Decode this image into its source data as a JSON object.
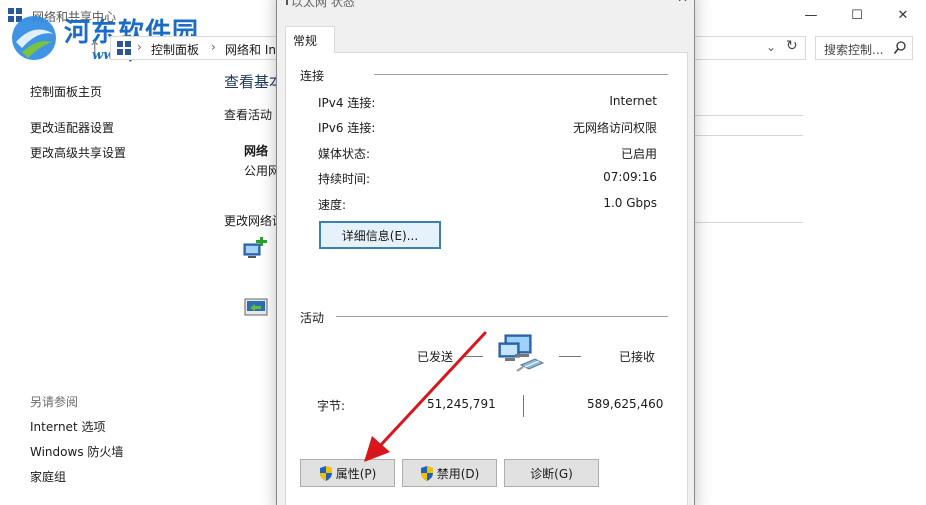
{
  "background_window": {
    "title": "网络和共享中心",
    "controls": {
      "minimize": "—",
      "maximize": "☐",
      "close": "✕"
    },
    "address_bar": {
      "crumbs": [
        "控制面板",
        "网络和 In"
      ],
      "search_placeholder": "搜索控制..."
    },
    "left_nav": {
      "home": "控制面板主页",
      "links": [
        "更改适配器设置",
        "更改高级共享设置"
      ],
      "see_also_title": "另请参阅",
      "see_also": [
        "Internet 选项",
        "Windows 防火墙",
        "家庭组"
      ]
    },
    "main": {
      "heading": "查看基本",
      "sub": "查看活动",
      "network_name": "网络",
      "network_type": "公用网",
      "change_heading": "更改网络设"
    }
  },
  "watermark": {
    "title": "河东软件园",
    "url": "www.pc0359.cn"
  },
  "dialog": {
    "title": "以太网 状态",
    "close": "✕",
    "tab_general": "常规",
    "connection_group": "连接",
    "rows": [
      {
        "label": "IPv4 连接:",
        "value": "Internet"
      },
      {
        "label": "IPv6 连接:",
        "value": "无网络访问权限"
      },
      {
        "label": "媒体状态:",
        "value": "已启用"
      },
      {
        "label": "持续时间:",
        "value": "07:09:16"
      },
      {
        "label": "速度:",
        "value": "1.0 Gbps"
      }
    ],
    "details_button": "详细信息(E)...",
    "activity_group": "活动",
    "sent_label": "已发送",
    "received_label": "已接收",
    "bytes_label": "字节:",
    "bytes_sent": "51,245,791",
    "bytes_received": "589,625,460",
    "buttons": {
      "properties": "属性(P)",
      "disable": "禁用(D)",
      "diagnose": "诊断(G)"
    }
  },
  "colors": {
    "accent_focus": "#3c7fb1",
    "watermark_blue": "#1a6cc7",
    "annotation_arrow": "#d9161c",
    "heading_blue": "#1e395b"
  }
}
